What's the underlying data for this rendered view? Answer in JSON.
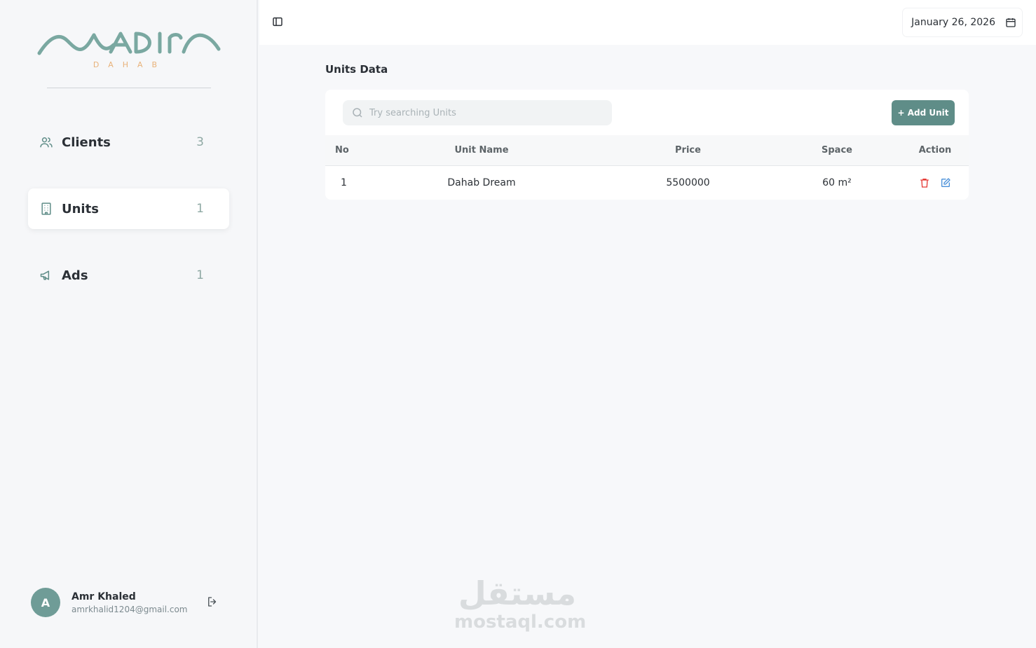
{
  "brand": {
    "logo_text": "NADIRA",
    "logo_sub": "DAHAB",
    "colors": {
      "primary": "#6f9c97",
      "accent": "#e8b27a"
    }
  },
  "sidebar": {
    "items": [
      {
        "label": "Clients",
        "count": "3",
        "icon": "users-icon"
      },
      {
        "label": "Units",
        "count": "1",
        "icon": "building-icon",
        "active": true
      },
      {
        "label": "Ads",
        "count": "1",
        "icon": "megaphone-icon"
      }
    ],
    "user": {
      "initial": "A",
      "name": "Amr Khaled",
      "email": "amrkhalid1204@gmail.com"
    }
  },
  "topbar": {
    "date": "January 26, 2026"
  },
  "main": {
    "title": "Units Data",
    "search_placeholder": "Try searching Units",
    "add_label": "+ Add Unit",
    "columns": [
      "No",
      "Unit Name",
      "Price",
      "Space",
      "Action"
    ],
    "rows": [
      {
        "no": "1",
        "name": "Dahab Dream",
        "price": "5500000",
        "space": "60 m²"
      }
    ]
  },
  "watermark": {
    "ar": "مستقل",
    "en": "mostaql.com"
  }
}
